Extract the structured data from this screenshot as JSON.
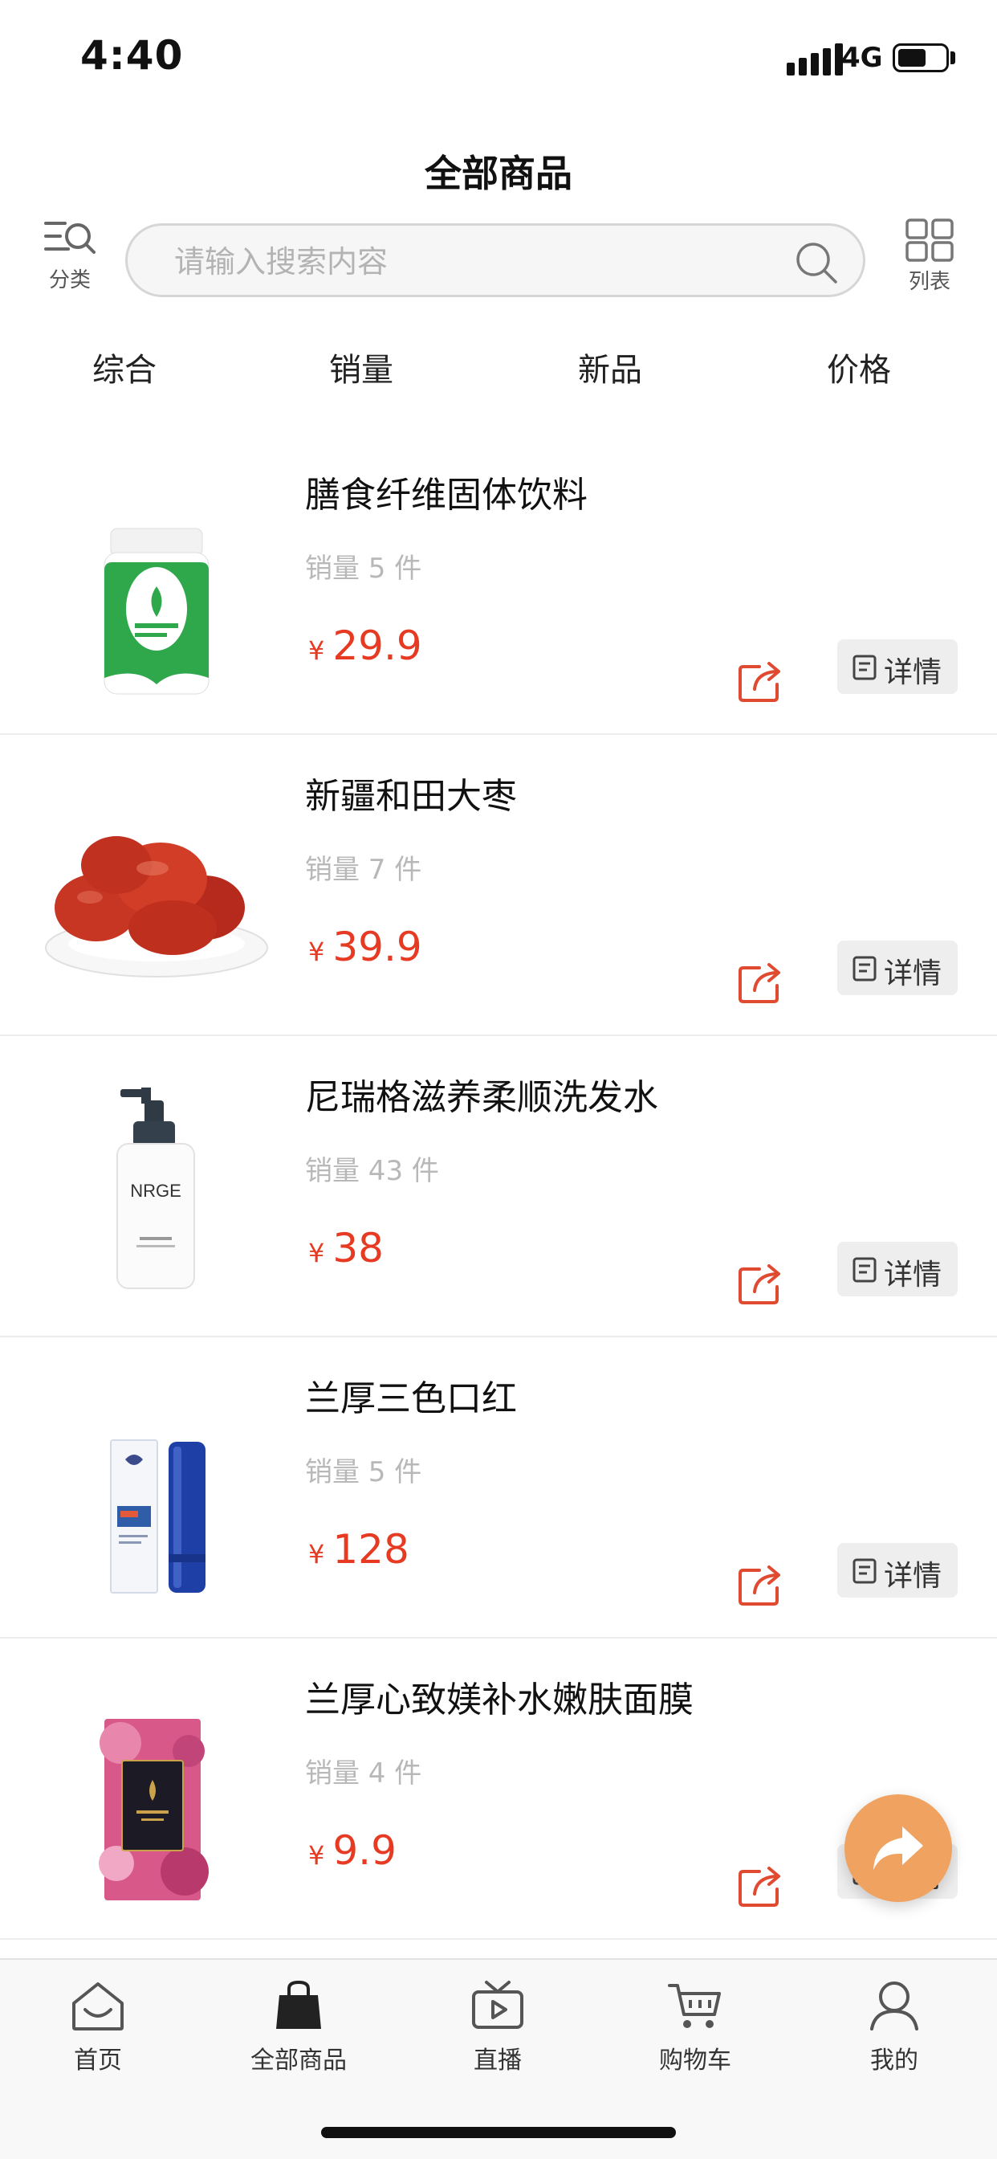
{
  "status_bar": {
    "time": "4:40",
    "network": "4G",
    "battery_level": 0.6
  },
  "header": {
    "title": "全部商品",
    "category_label": "分类",
    "list_label": "列表"
  },
  "search": {
    "placeholder": "请输入搜索内容",
    "value": ""
  },
  "sort_tabs": [
    "综合",
    "销量",
    "新品",
    "价格"
  ],
  "products": [
    {
      "name": "膳食纤维固体饮料",
      "sales": "销量 5 件",
      "currency": "¥",
      "price": "29.9",
      "detail_label": "详情",
      "image": "green-supplement-jar"
    },
    {
      "name": "新疆和田大枣",
      "sales": "销量 7 件",
      "currency": "¥",
      "price": "39.9",
      "detail_label": "详情",
      "image": "red-dates-plate"
    },
    {
      "name": "尼瑞格滋养柔顺洗发水",
      "sales": "销量 43 件",
      "currency": "¥",
      "price": "38",
      "detail_label": "详情",
      "image": "shampoo-pump-bottle",
      "brand_text": "NRGE"
    },
    {
      "name": "兰厚三色口红",
      "sales": "销量 5 件",
      "currency": "¥",
      "price": "128",
      "detail_label": "详情",
      "image": "blue-lipstick-box"
    },
    {
      "name": "兰厚心致媄补水嫩肤面膜",
      "sales": "销量 4 件",
      "currency": "¥",
      "price": "9.9",
      "detail_label": "详情",
      "image": "pink-face-mask-pack"
    }
  ],
  "bottom_nav": [
    {
      "label": "首页",
      "icon": "home-icon"
    },
    {
      "label": "全部商品",
      "icon": "bag-icon",
      "active": true
    },
    {
      "label": "直播",
      "icon": "tv-icon"
    },
    {
      "label": "购物车",
      "icon": "cart-icon"
    },
    {
      "label": "我的",
      "icon": "user-icon"
    }
  ],
  "colors": {
    "price": "#e63a22",
    "fab": "#f0a260",
    "share_icon": "#e04a30"
  }
}
